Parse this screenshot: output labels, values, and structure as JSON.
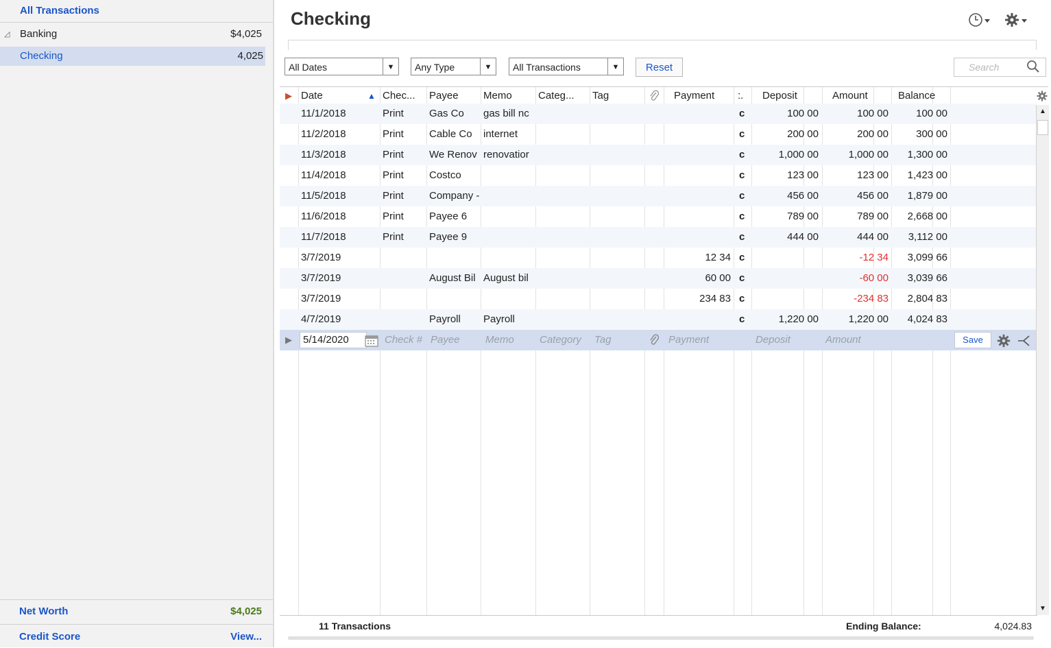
{
  "sidebar": {
    "all_transactions": "All Transactions",
    "group_label": "Banking",
    "group_value": "$4,025",
    "account_label": "Checking",
    "account_value": "4,025",
    "net_worth_label": "Net Worth",
    "net_worth_value": "$4,025",
    "credit_score_label": "Credit Score",
    "credit_score_link": "View..."
  },
  "header": {
    "title": "Checking",
    "history_icon": "clock-icon",
    "settings_icon": "gear-icon"
  },
  "filters": {
    "dates": "All Dates",
    "type": "Any Type",
    "transactions": "All Transactions",
    "reset": "Reset",
    "search_placeholder": "Search"
  },
  "columns": {
    "date": "Date",
    "check": "Chec...",
    "payee": "Payee",
    "memo": "Memo",
    "category": "Categ...",
    "tag": "Tag",
    "payment": "Payment",
    "cleared": ":.",
    "deposit": "Deposit",
    "amount": "Amount",
    "balance": "Balance"
  },
  "transactions": [
    {
      "date": "11/1/2018",
      "check": "Print",
      "payee": "Gas Co",
      "memo": "gas bill nc",
      "payment": "",
      "cleared": "c",
      "deposit": "100 00",
      "amount": "100 00",
      "balance": "100 00",
      "negative": false
    },
    {
      "date": "11/2/2018",
      "check": "Print",
      "payee": "Cable Co",
      "memo": "internet",
      "payment": "",
      "cleared": "c",
      "deposit": "200 00",
      "amount": "200 00",
      "balance": "300 00",
      "negative": false
    },
    {
      "date": "11/3/2018",
      "check": "Print",
      "payee": "We Renov",
      "memo": "renovatior",
      "payment": "",
      "cleared": "c",
      "deposit": "1,000 00",
      "amount": "1,000 00",
      "balance": "1,300 00",
      "negative": false
    },
    {
      "date": "11/4/2018",
      "check": "Print",
      "payee": "Costco",
      "memo": "",
      "payment": "",
      "cleared": "c",
      "deposit": "123 00",
      "amount": "123 00",
      "balance": "1,423 00",
      "negative": false
    },
    {
      "date": "11/5/2018",
      "check": "Print",
      "payee": "Company -",
      "memo": "",
      "payment": "",
      "cleared": "c",
      "deposit": "456 00",
      "amount": "456 00",
      "balance": "1,879 00",
      "negative": false
    },
    {
      "date": "11/6/2018",
      "check": "Print",
      "payee": "Payee 6",
      "memo": "",
      "payment": "",
      "cleared": "c",
      "deposit": "789 00",
      "amount": "789 00",
      "balance": "2,668 00",
      "negative": false
    },
    {
      "date": "11/7/2018",
      "check": "Print",
      "payee": "Payee 9",
      "memo": "",
      "payment": "",
      "cleared": "c",
      "deposit": "444 00",
      "amount": "444 00",
      "balance": "3,112 00",
      "negative": false
    },
    {
      "date": "3/7/2019",
      "check": "",
      "payee": "",
      "memo": "",
      "payment": "12 34",
      "cleared": "c",
      "deposit": "",
      "amount": "-12 34",
      "balance": "3,099 66",
      "negative": true
    },
    {
      "date": "3/7/2019",
      "check": "",
      "payee": "August Bil",
      "memo": "August bil",
      "payment": "60 00",
      "cleared": "c",
      "deposit": "",
      "amount": "-60 00",
      "balance": "3,039 66",
      "negative": true
    },
    {
      "date": "3/7/2019",
      "check": "",
      "payee": "",
      "memo": "",
      "payment": "234 83",
      "cleared": "c",
      "deposit": "",
      "amount": "-234 83",
      "balance": "2,804 83",
      "negative": true
    },
    {
      "date": "4/7/2019",
      "check": "",
      "payee": "Payroll",
      "memo": "Payroll",
      "payment": "",
      "cleared": "c",
      "deposit": "1,220 00",
      "amount": "1,220 00",
      "balance": "4,024 83",
      "negative": false
    }
  ],
  "entry": {
    "date": "5/14/2020",
    "check_ph": "Check #",
    "payee_ph": "Payee",
    "memo_ph": "Memo",
    "category_ph": "Category",
    "tag_ph": "Tag",
    "payment_ph": "Payment",
    "deposit_ph": "Deposit",
    "amount_ph": "Amount",
    "save": "Save"
  },
  "footer": {
    "count": "11 Transactions",
    "ending_label": "Ending Balance:",
    "ending_value": "4,024.83"
  }
}
